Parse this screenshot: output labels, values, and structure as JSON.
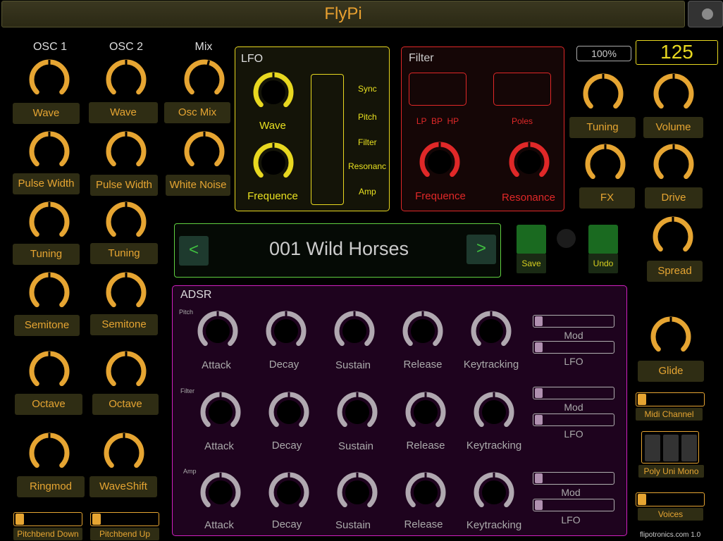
{
  "app": {
    "title": "FlyPi"
  },
  "colors": {
    "accent": "#e6a532",
    "lfo": "#e8d820",
    "filter": "#e02828",
    "adsr": "#d020c0",
    "preset": "#60d040"
  },
  "osc1": {
    "header": "OSC 1",
    "wave": "Wave",
    "pulse_width": "Pulse Width",
    "tuning": "Tuning",
    "semitone": "Semitone",
    "octave": "Octave",
    "ringmod": "Ringmod"
  },
  "osc2": {
    "header": "OSC 2",
    "wave": "Wave",
    "pulse_width": "Pulse Width",
    "tuning": "Tuning",
    "semitone": "Semitone",
    "octave": "Octave",
    "waveshift": "WaveShift"
  },
  "mix": {
    "header": "Mix",
    "osc_mix": "Osc Mix",
    "white_noise": "White Noise"
  },
  "pitchbend": {
    "down": "Pitchbend Down",
    "up": "Pitchbend Up"
  },
  "lfo": {
    "title": "LFO",
    "wave": "Wave",
    "frequence": "Frequence",
    "targets": [
      "Sync",
      "Pitch",
      "Filter",
      "Resonanc",
      "Amp"
    ]
  },
  "filter": {
    "title": "Filter",
    "modes": "LP  BP  HP",
    "poles": "Poles",
    "frequence": "Frequence",
    "resonance": "Resonance"
  },
  "master": {
    "percent": "100%",
    "bpm": "125",
    "tuning": "Tuning",
    "volume": "Volume",
    "fx": "FX",
    "drive": "Drive",
    "spread": "Spread",
    "glide": "Glide",
    "midi_channel": "Midi Channel",
    "poly_mode": "Poly Uni Mono",
    "voices": "Voices"
  },
  "preset": {
    "prev": "<",
    "next": ">",
    "name": "001 Wild Horses",
    "save": "Save",
    "undo": "Undo"
  },
  "adsr": {
    "title": "ADSR",
    "rows": [
      {
        "name": "Pitch",
        "knobs": [
          "Attack",
          "Decay",
          "Sustain",
          "Release",
          "Keytracking"
        ],
        "mod": "Mod",
        "lfo": "LFO"
      },
      {
        "name": "Filter",
        "knobs": [
          "Attack",
          "Decay",
          "Sustain",
          "Release",
          "Keytracking"
        ],
        "mod": "Mod",
        "lfo": "LFO"
      },
      {
        "name": "Amp",
        "knobs": [
          "Attack",
          "Decay",
          "Sustain",
          "Release",
          "Keytracking"
        ],
        "mod": "Mod",
        "lfo": "LFO"
      }
    ]
  },
  "footer": {
    "credit": "flipotronics.com 1.0"
  }
}
